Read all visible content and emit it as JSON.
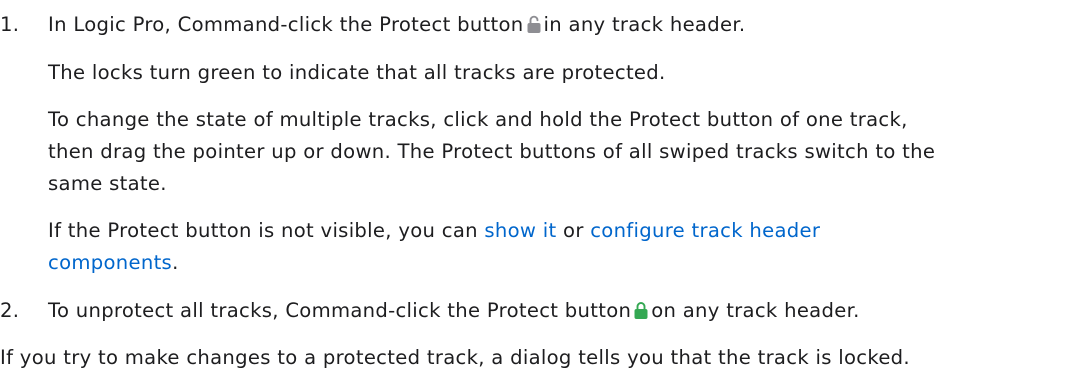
{
  "steps": [
    {
      "number": "1.",
      "pre": "In Logic Pro, Command-click the Protect button",
      "icon": "unlocked-padlock-icon",
      "post": "in any track header.",
      "p1": "The locks turn green to indicate that all tracks are protected.",
      "p2_line1": "To change the state of multiple tracks, click and hold the Protect button of one track,",
      "p2_line2": "then drag the pointer up or down. The Protect buttons of all swiped tracks switch to the",
      "p2_line3": "same state.",
      "p3_pre": "If the Protect button is not visible, you can",
      "p3_link1": "show it",
      "p3_mid": "or",
      "p3_link2a": "configure track header",
      "p3_link2b": "components",
      "p3_end": "."
    },
    {
      "number": "2.",
      "pre": "To unprotect all tracks, Command-click the Protect button",
      "icon": "locked-padlock-green-icon",
      "post": "on any track header."
    }
  ],
  "closing": "If you try to make changes to a protected track, a dialog tells you that the track is locked.",
  "colors": {
    "text": "#1d1d1f",
    "link": "#0066cc",
    "lock_gray": "#8e8e93",
    "lock_green": "#34a853"
  }
}
